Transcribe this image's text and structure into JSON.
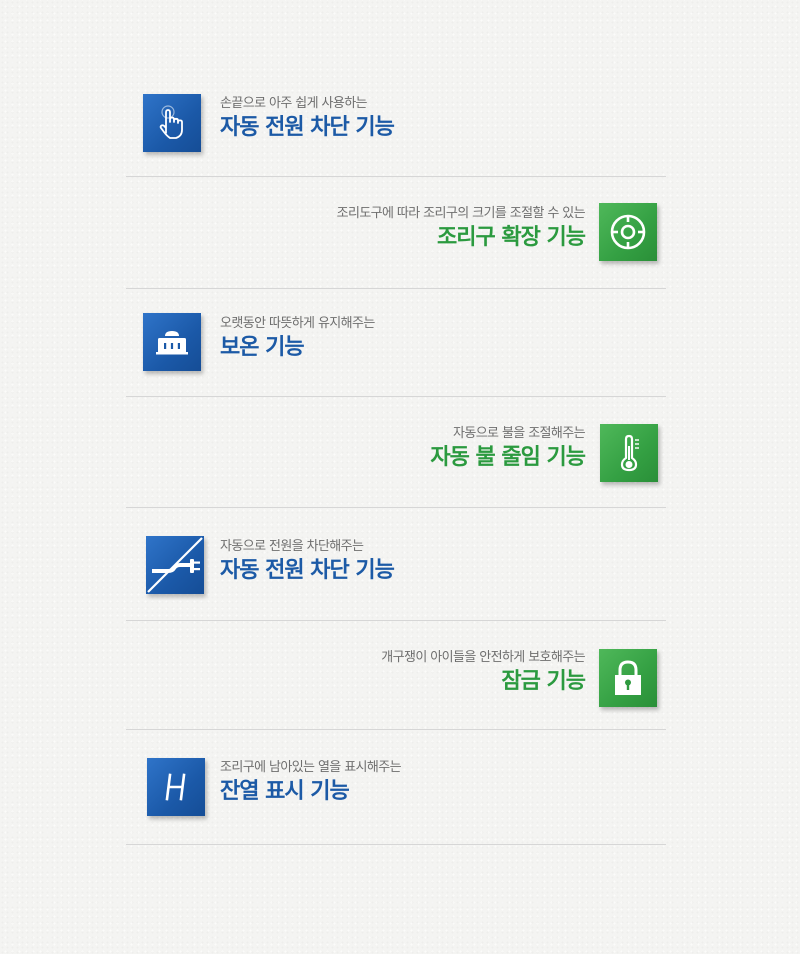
{
  "features": [
    {
      "subtitle": "손끝으로 아주 쉽게 사용하는",
      "title": "자동 전원 차단 기능",
      "icon": "touch-hand-icon",
      "color": "blue",
      "align": "left"
    },
    {
      "subtitle": "조리도구에 따라 조리구의 크기를 조절할 수 있는",
      "title": "조리구 확장 기능",
      "icon": "target-expand-icon",
      "color": "green",
      "align": "right"
    },
    {
      "subtitle": "오랫동안 따뜻하게 유지해주는",
      "title": "보온 기능",
      "icon": "warming-pot-icon",
      "color": "blue",
      "align": "left"
    },
    {
      "subtitle": "자동으로 불을 조절해주는",
      "title": "자동 불 줄임 기능",
      "icon": "thermometer-icon",
      "color": "green",
      "align": "right"
    },
    {
      "subtitle": "자동으로 전원을 차단해주는",
      "title": "자동 전원 차단 기능",
      "icon": "power-plug-off-icon",
      "color": "blue",
      "align": "left"
    },
    {
      "subtitle": "개구쟁이 아이들을 안전하게 보호해주는",
      "title": "잠금 기능",
      "icon": "padlock-icon",
      "color": "green",
      "align": "right"
    },
    {
      "subtitle": "조리구에 남아있는 열을 표시해주는",
      "title": "잔열 표시 기능",
      "icon": "residual-heat-h-icon",
      "color": "blue",
      "align": "left"
    }
  ],
  "colors": {
    "blue": "#1c5aa6",
    "green": "#2b9a3f",
    "divider": "#d6d6d6",
    "subtitle": "#6e6e6e"
  }
}
